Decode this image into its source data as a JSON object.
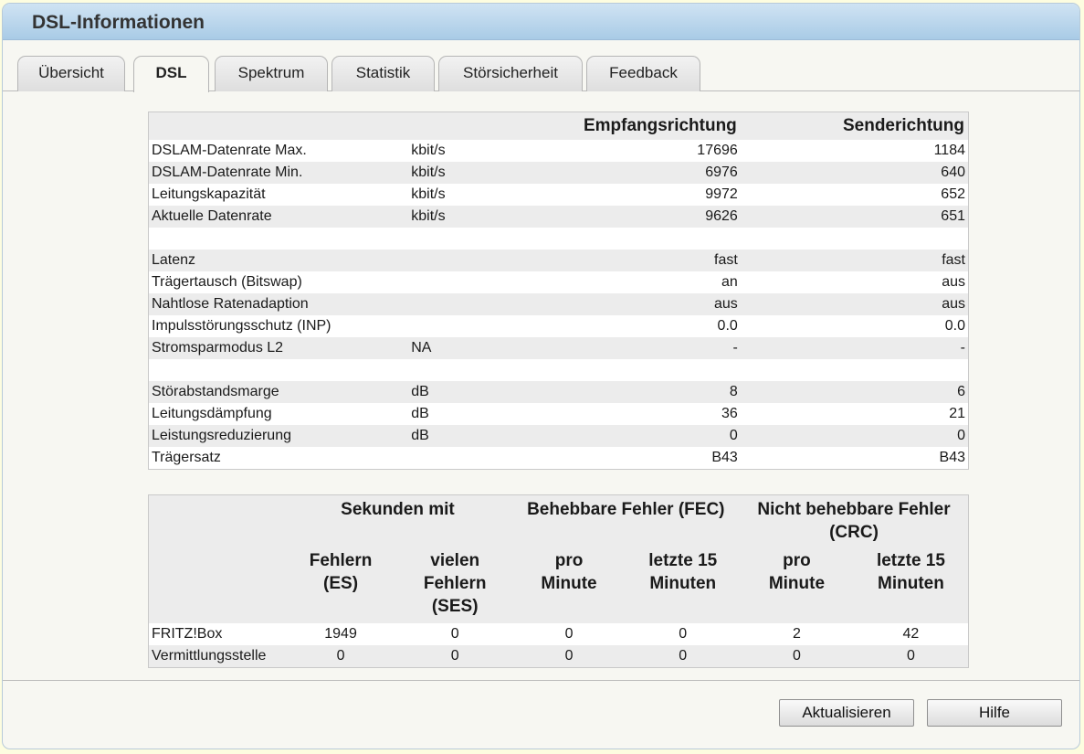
{
  "title": "DSL-Informationen",
  "tabs": [
    "Übersicht",
    "DSL",
    "Spektrum",
    "Statistik",
    "Störsicherheit",
    "Feedback"
  ],
  "active_tab": "DSL",
  "info": {
    "headers": [
      "",
      "",
      "Empfangsrichtung",
      "Senderichtung"
    ],
    "rows": [
      [
        "DSLAM-Datenrate Max.",
        "kbit/s",
        "17696",
        "1184"
      ],
      [
        "DSLAM-Datenrate Min.",
        "kbit/s",
        "6976",
        "640"
      ],
      [
        "Leitungskapazität",
        "kbit/s",
        "9972",
        "652"
      ],
      [
        "Aktuelle Datenrate",
        "kbit/s",
        "9626",
        "651"
      ],
      [
        "",
        "",
        "",
        ""
      ],
      [
        "Latenz",
        "",
        "fast",
        "fast"
      ],
      [
        "Trägertausch (Bitswap)",
        "",
        "an",
        "aus"
      ],
      [
        "Nahtlose Ratenadaption",
        "",
        "aus",
        "aus"
      ],
      [
        "Impulsstörungsschutz (INP)",
        "",
        "0.0",
        "0.0"
      ],
      [
        "Stromsparmodus L2",
        "NA",
        "-",
        "-"
      ],
      [
        "",
        "",
        "",
        ""
      ],
      [
        "Störabstandsmarge",
        "dB",
        "8",
        "6"
      ],
      [
        "Leitungsdämpfung",
        "dB",
        "36",
        "21"
      ],
      [
        "Leistungsreduzierung",
        "dB",
        "0",
        "0"
      ],
      [
        "Trägersatz",
        "",
        "B43",
        "B43"
      ]
    ]
  },
  "errors": {
    "group_headers": [
      "Sekunden mit",
      "Behebbare Fehler (FEC)",
      "Nicht behebbare Fehler (CRC)"
    ],
    "sub_headers": [
      "Fehlern (ES)",
      "vielen Fehlern (SES)",
      "pro Minute",
      "letzte 15 Minuten",
      "pro Minute",
      "letzte 15 Minuten"
    ],
    "rows": [
      [
        "FRITZ!Box",
        "1949",
        "0",
        "0",
        "0",
        "2",
        "42"
      ],
      [
        "Vermittlungsstelle",
        "0",
        "0",
        "0",
        "0",
        "0",
        "0"
      ]
    ]
  },
  "buttons": {
    "refresh": "Aktualisieren",
    "help": "Hilfe"
  }
}
